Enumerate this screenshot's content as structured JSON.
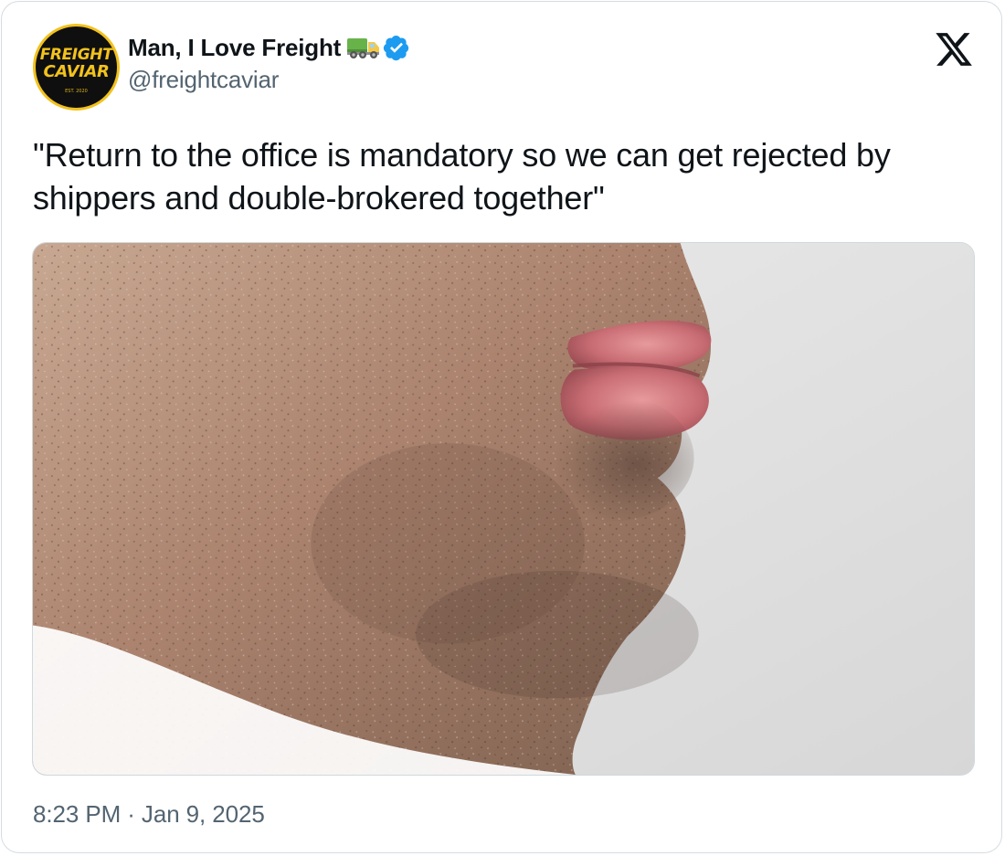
{
  "tweet": {
    "author": {
      "display_name": "Man, I Love Freight",
      "handle": "@freightcaviar",
      "avatar_logo_line1": "FREIGHT",
      "avatar_logo_line2": "CAVIAR",
      "avatar_logo_sub": "EST. 2020"
    },
    "text": "\"Return to the office is mandatory so we can get rejected by shippers and double-brokered together\"",
    "timestamp": "8:23 PM · Jan 9, 2025",
    "icons": {
      "name_emoji": "truck-icon",
      "verified": "verified-badge-icon",
      "platform": "x-logo-icon"
    },
    "colors": {
      "text": "#0f1419",
      "secondary": "#536471",
      "verified": "#1d9bf0",
      "border": "#cfd9de",
      "avatar_bg": "#0f0f0f",
      "avatar_accent": "#f2c21d"
    }
  }
}
